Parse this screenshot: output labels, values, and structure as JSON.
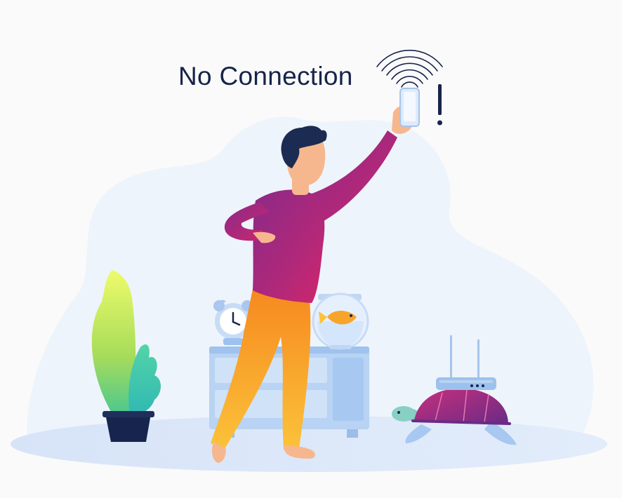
{
  "headline": "No Connection",
  "colors": {
    "page_background": "#fafafa",
    "scene_blob": "#eef4fb",
    "floor": "#dbe7f8",
    "headline_text": "#16244a",
    "shirt": "#a0287a",
    "pants": "#f7a52a",
    "skin": "#f6b78f",
    "hair": "#1c2b52",
    "dresser": "#b8d3f3",
    "turtle_shell": "#a0287a",
    "router": "#9cc1ee",
    "plant_leaf": "#a6dc5a",
    "pot": "#17244e"
  },
  "icons": [
    "wifi-signal-icon",
    "exclamation-icon",
    "alarm-clock-icon",
    "goldfish-bowl-icon",
    "router-icon",
    "turtle-icon",
    "potted-plant-icon",
    "phone-icon"
  ]
}
